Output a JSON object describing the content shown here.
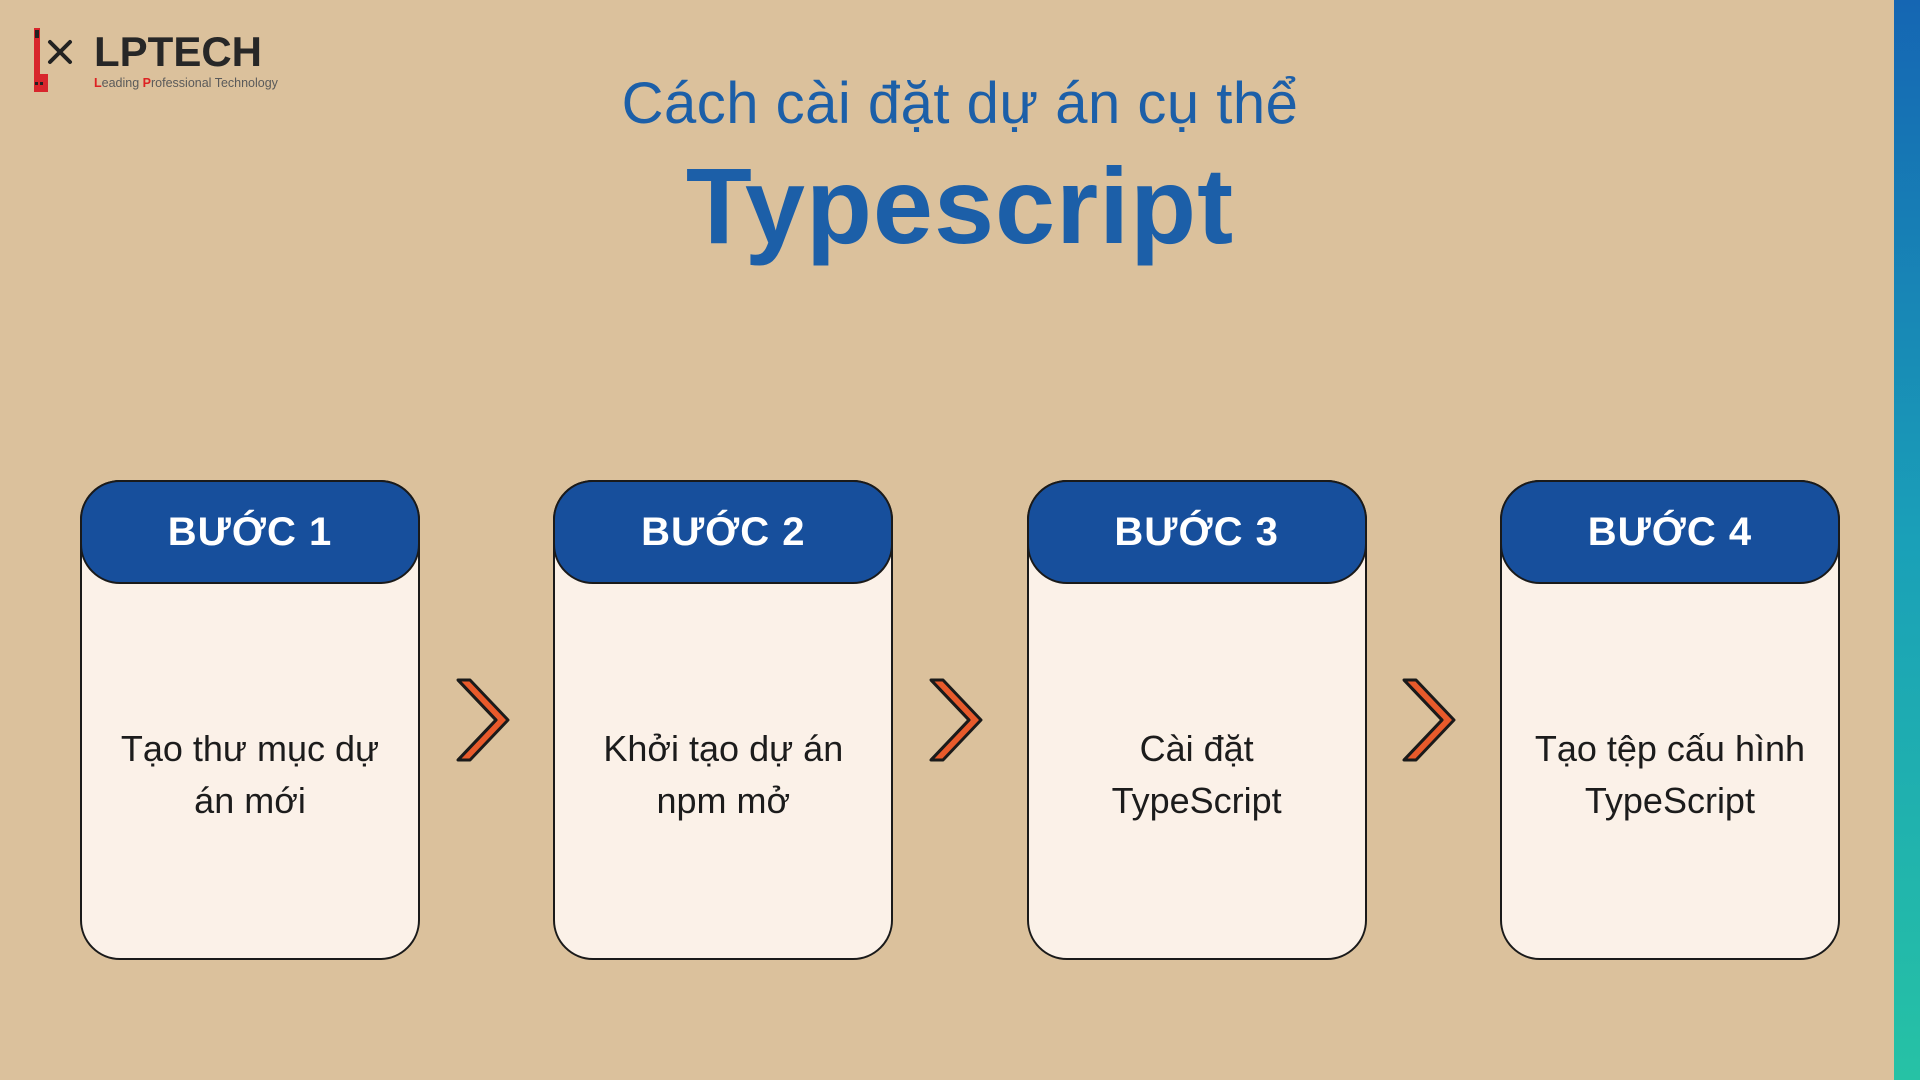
{
  "logo": {
    "main": "LPTECH",
    "sub_prefix_l": "L",
    "sub_word1_rest": "eading ",
    "sub_prefix_p": "P",
    "sub_word2_rest": "rofessional Technology"
  },
  "heading": {
    "line1": "Cách cài đặt dự án cụ thể",
    "line2": "Typescript"
  },
  "steps": [
    {
      "label": "BƯỚC 1",
      "desc": "Tạo thư mục dự án mới"
    },
    {
      "label": "BƯỚC 2",
      "desc": "Khởi tạo dự án npm mở"
    },
    {
      "label": "BƯỚC 3",
      "desc": "Cài đặt TypeScript"
    },
    {
      "label": "BƯỚC 4",
      "desc": "Tạo tệp cấu hình TypeScript"
    }
  ],
  "colors": {
    "brand_blue": "#174f9c",
    "arrow_fill": "#e85a2b",
    "arrow_stroke": "#1a1a1a"
  }
}
